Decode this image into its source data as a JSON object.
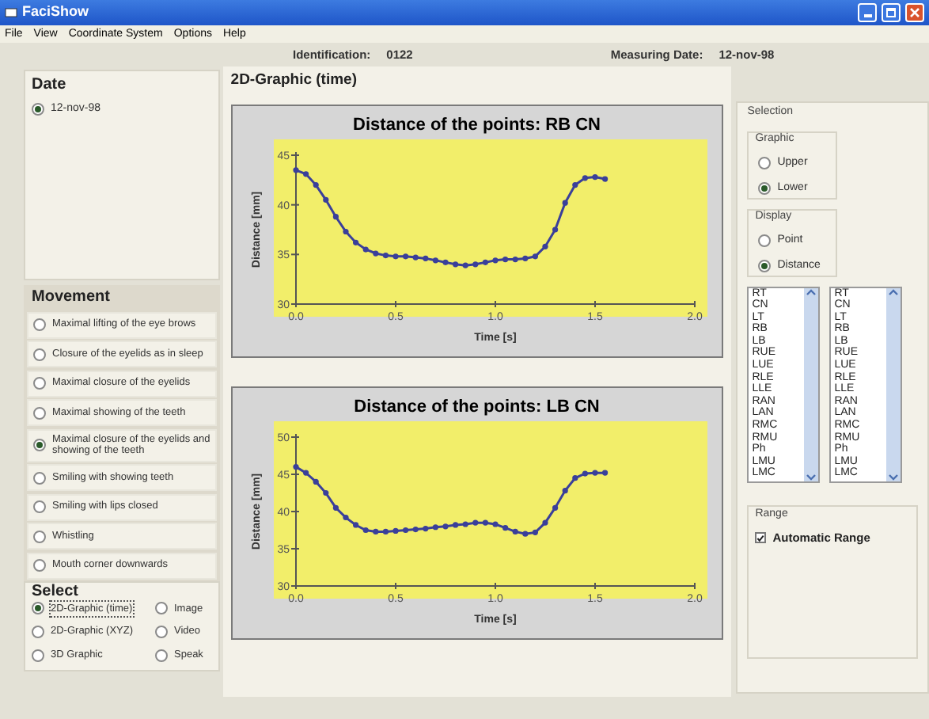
{
  "window": {
    "title": "FaciShow"
  },
  "menu": [
    "File",
    "View",
    "Coordinate System",
    "Options",
    "Help"
  ],
  "info": [
    {
      "label": "Identification:",
      "value": "0122"
    },
    {
      "label": "Measuring Date:",
      "value": "12-nov-98"
    }
  ],
  "date_panel": {
    "title": "Date",
    "options": [
      {
        "label": "12-nov-98",
        "selected": true
      }
    ]
  },
  "movement": {
    "title": "Movement",
    "options": [
      {
        "label": "Maximal lifting of the eye brows",
        "selected": false
      },
      {
        "label": "Closure of the eyelids as in sleep",
        "selected": false
      },
      {
        "label": "Maximal closure of the eyelids",
        "selected": false
      },
      {
        "label": "Maximal showing of the teeth",
        "selected": false
      },
      {
        "label": "Maximal closure of the eyelids and showing of the teeth",
        "selected": true
      },
      {
        "label": "Smiling with showing teeth",
        "selected": false
      },
      {
        "label": "Smiling with lips closed",
        "selected": false
      },
      {
        "label": "Whistling",
        "selected": false
      },
      {
        "label": "Mouth corner downwards",
        "selected": false
      }
    ]
  },
  "select": {
    "title": "Select",
    "options": [
      {
        "label": "2D-Graphic (time)",
        "selected": true
      },
      {
        "label": "Image",
        "selected": false
      },
      {
        "label": "2D-Graphic (XYZ)",
        "selected": false
      },
      {
        "label": "Video",
        "selected": false
      },
      {
        "label": "3D Graphic",
        "selected": false
      },
      {
        "label": "Speak",
        "selected": false
      }
    ]
  },
  "graphic": {
    "title": "2D-Graphic (time)",
    "charts": [
      {
        "chart_data": {
          "type": "line",
          "title": "Distance of the points: RB CN",
          "xlabel": "Time [s]",
          "ylabel": "Distance [mm]",
          "x": [
            0,
            0.05,
            0.1,
            0.15,
            0.2,
            0.25,
            0.3,
            0.35,
            0.4,
            0.45,
            0.5,
            0.55,
            0.6,
            0.65,
            0.7,
            0.75,
            0.8,
            0.85,
            0.9,
            0.95,
            1.0,
            1.05,
            1.1,
            1.15,
            1.2,
            1.25,
            1.3,
            1.35,
            1.4,
            1.45,
            1.5,
            1.55
          ],
          "series": [
            {
              "color": "#3a3f9a",
              "marker": "circle",
              "values": [
                43.5,
                43.1,
                42,
                40.5,
                38.8,
                37.3,
                36.2,
                35.5,
                35.1,
                34.9,
                34.8,
                34.8,
                34.7,
                34.6,
                34.4,
                34.2,
                34.0,
                33.9,
                34.0,
                34.2,
                34.4,
                34.5,
                34.5,
                34.6,
                34.8,
                35.8,
                37.5,
                40.2,
                42.0,
                42.7,
                42.8,
                42.6
              ]
            }
          ],
          "xlim": [
            0,
            2
          ],
          "ylim": [
            30,
            45
          ],
          "xticks": [
            {
              "value": 0,
              "label": "0.0"
            },
            {
              "value": 0.5,
              "label": "0.5"
            },
            {
              "value": 1,
              "label": "1.0"
            },
            {
              "value": 1.5,
              "label": "1.5"
            },
            {
              "value": 2,
              "label": "2.0"
            }
          ],
          "yticks": [
            30,
            35,
            40,
            45
          ]
        }
      },
      {
        "chart_data": {
          "type": "line",
          "title": "Distance of the points: LB CN",
          "xlabel": "Time [s]",
          "ylabel": "Distance [mm]",
          "x": [
            0,
            0.05,
            0.1,
            0.15,
            0.2,
            0.25,
            0.3,
            0.35,
            0.4,
            0.45,
            0.5,
            0.55,
            0.6,
            0.65,
            0.7,
            0.75,
            0.8,
            0.85,
            0.9,
            0.95,
            1.0,
            1.05,
            1.1,
            1.15,
            1.2,
            1.25,
            1.3,
            1.35,
            1.4,
            1.45,
            1.5,
            1.55
          ],
          "series": [
            {
              "color": "#3a3f9a",
              "marker": "circle",
              "values": [
                46,
                45.2,
                44,
                42.5,
                40.5,
                39.2,
                38.2,
                37.5,
                37.3,
                37.3,
                37.4,
                37.5,
                37.6,
                37.7,
                37.9,
                38.0,
                38.2,
                38.3,
                38.5,
                38.5,
                38.3,
                37.8,
                37.3,
                37.0,
                37.2,
                38.5,
                40.5,
                42.8,
                44.5,
                45.1,
                45.2,
                45.2
              ]
            }
          ],
          "xlim": [
            0,
            2
          ],
          "ylim": [
            30,
            50
          ],
          "xticks": [
            {
              "value": 0,
              "label": "0.0"
            },
            {
              "value": 0.5,
              "label": "0.5"
            },
            {
              "value": 1,
              "label": "1.0"
            },
            {
              "value": 1.5,
              "label": "1.5"
            },
            {
              "value": 2,
              "label": "2.0"
            }
          ],
          "yticks": [
            30,
            35,
            40,
            45,
            50
          ]
        }
      }
    ]
  },
  "selection": {
    "title": "Selection",
    "graphic": {
      "title": "Graphic",
      "options": [
        {
          "label": "Upper",
          "selected": false
        },
        {
          "label": "Lower",
          "selected": true
        }
      ]
    },
    "display": {
      "title": "Display",
      "options": [
        {
          "label": "Point",
          "selected": false
        },
        {
          "label": "Distance",
          "selected": true
        }
      ]
    },
    "lists": [
      [
        "RT",
        "CN",
        "LT",
        "RB",
        "LB",
        "RUE",
        "LUE",
        "RLE",
        "LLE",
        "RAN",
        "LAN",
        "RMC",
        "RMU",
        "Ph",
        "LMU",
        "LMC"
      ],
      [
        "RT",
        "CN",
        "LT",
        "RB",
        "LB",
        "RUE",
        "LUE",
        "RLE",
        "LLE",
        "RAN",
        "LAN",
        "RMC",
        "RMU",
        "Ph",
        "LMU",
        "LMC"
      ]
    ],
    "range": {
      "title": "Range",
      "automatic": {
        "label": "Automatic Range",
        "checked": true
      }
    }
  }
}
